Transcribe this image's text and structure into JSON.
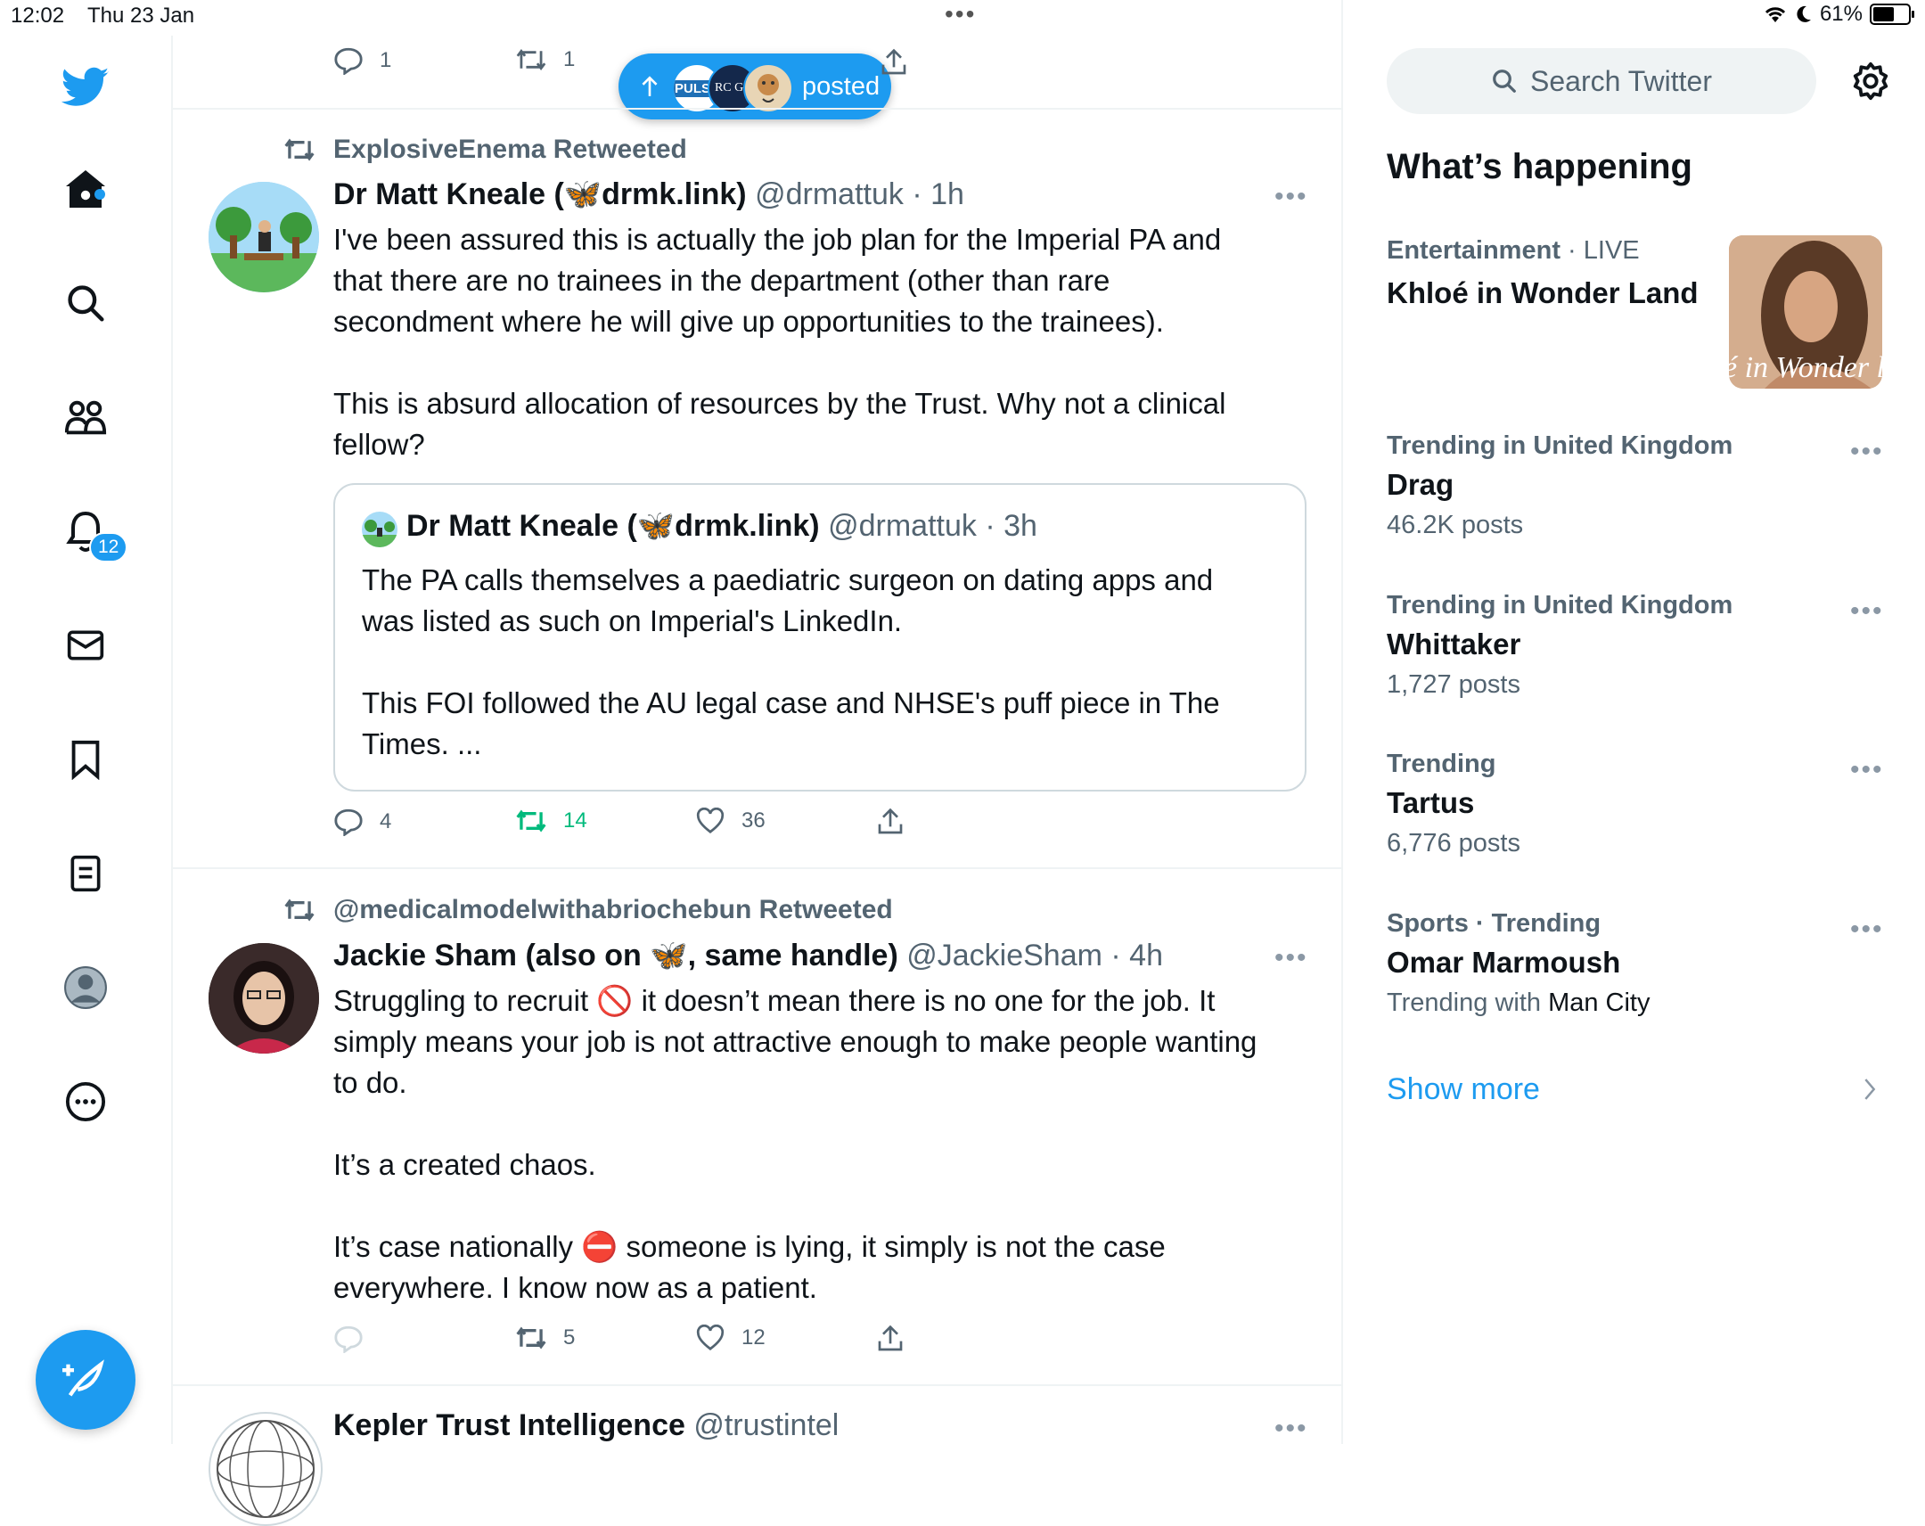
{
  "status_bar": {
    "time": "12:02",
    "date": "Thu 23 Jan",
    "battery": "61%",
    "battery_level": 0.61
  },
  "nav": {
    "notifications_badge": "12",
    "items": [
      "twitter-logo",
      "home",
      "explore",
      "communities",
      "notifications",
      "messages",
      "bookmarks",
      "lists",
      "profile",
      "more"
    ]
  },
  "top_tweet_actions": {
    "replies": "1",
    "retweets": "1"
  },
  "new_posts_pill": {
    "label": "posted",
    "avatar_text_1": "PULSE",
    "avatar_text_2": "RC GP"
  },
  "tweets": [
    {
      "retweeted_by": "ExplosiveEnema Retweeted",
      "name": "Dr Matt Kneale (🦋drmk.link)",
      "handle": "@drmattuk",
      "time": "· 1h",
      "text": "I've been assured this is actually the job plan for the Imperial PA and\nthat there are no trainees in the department (other than rare\nsecondment where he will give up opportunities to the trainees).\n\nThis is absurd allocation of resources by the Trust. Why not a clinical\nfellow?",
      "quote": {
        "name": "Dr Matt Kneale (🦋drmk.link)",
        "handle": "@drmattuk",
        "time": "· 3h",
        "text": "The PA calls themselves a paediatric surgeon on dating apps and\nwas listed as such on Imperial's LinkedIn.\n\nThis FOI followed the AU legal case and NHSE's puff piece in The\nTimes. ..."
      },
      "replies": "4",
      "retweets": "14",
      "likes": "36"
    },
    {
      "retweeted_by": "@medicalmodelwithabriochebun Retweeted",
      "name": "Jackie Sham (also on 🦋, same handle)",
      "handle": "@JackieSham",
      "time": "· 4h",
      "text": "Struggling to recruit 🚫 it doesn’t mean there is no one for the job. It\nsimply means your job is not attractive enough to make people wanting\nto do.\n\nIt’s a created chaos.\n\nIt’s case nationally ⛔ someone is lying, it simply is not the case\neverywhere. I know now as a patient.",
      "replies": "",
      "retweets": "5",
      "likes": "12"
    },
    {
      "name": "Kepler Trust Intelligence",
      "handle": "@trustintel"
    }
  ],
  "sidebar": {
    "search_placeholder": "Search Twitter",
    "heading": "What’s happening",
    "featured": {
      "category": "Entertainment",
      "live": "· LIVE",
      "title": "Khloé in Wonder Land",
      "image_caption": "é in Wonder l"
    },
    "trends": [
      {
        "context": "Trending in United Kingdom",
        "title": "Drag",
        "sub": "46.2K posts"
      },
      {
        "context": "Trending in United Kingdom",
        "title": "Whittaker",
        "sub": "1,727 posts"
      },
      {
        "context": "Trending",
        "title": "Tartus",
        "sub": "6,776 posts"
      },
      {
        "context": "Sports · Trending",
        "title": "Omar Marmoush",
        "sub_prefix": "Trending with ",
        "sub_strong": "Man City"
      }
    ],
    "show_more": "Show more"
  },
  "colors": {
    "accent": "#1d9bf0",
    "retweet_green": "#00ba7c",
    "secondary_text": "#536471"
  }
}
